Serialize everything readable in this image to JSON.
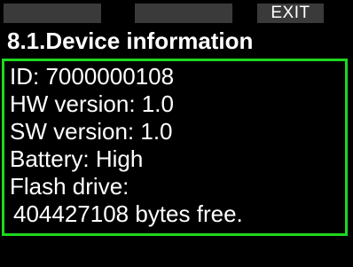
{
  "softkeys": {
    "left_label": "",
    "middle_label": "",
    "right_label": "EXIT"
  },
  "title": "8.1.Device information",
  "info": {
    "id": "ID: 7000000108",
    "hw_version": "HW version: 1.0",
    "sw_version": "SW version: 1.0",
    "battery": "Battery: High",
    "flash_label": "Flash  drive:",
    "flash_free": "404427108 bytes free."
  },
  "colors": {
    "background": "#000000",
    "panel_border": "#1ed71e",
    "softkey_bg": "#3a3a3a",
    "text": "#ffffff"
  }
}
